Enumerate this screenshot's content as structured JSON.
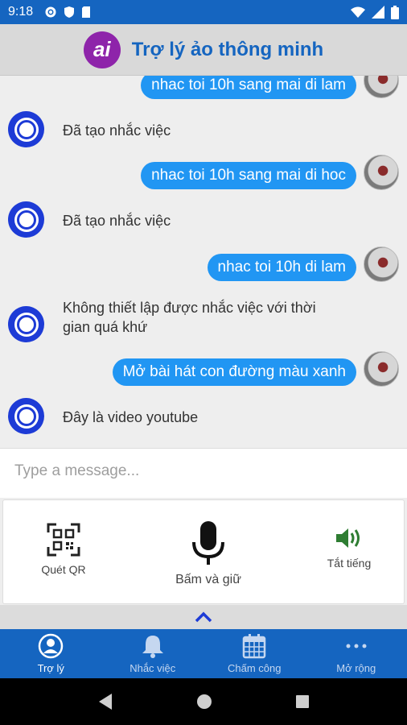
{
  "status_bar": {
    "time": "9:18"
  },
  "header": {
    "logo_text": "ai",
    "title": "Trợ lý ảo thông minh"
  },
  "messages": [
    {
      "from": "user",
      "text": "nhac toi 10h sang mai di lam"
    },
    {
      "from": "bot",
      "text": "Đã tạo nhắc việc"
    },
    {
      "from": "user",
      "text": "nhac toi 10h sang mai di hoc"
    },
    {
      "from": "bot",
      "text": "Đã tạo nhắc việc"
    },
    {
      "from": "user",
      "text": "nhac toi 10h di lam"
    },
    {
      "from": "bot",
      "text": "Không thiết lập được nhắc việc với thời gian quá khứ"
    },
    {
      "from": "user",
      "text": "Mở bài hát con đường màu xanh"
    },
    {
      "from": "bot",
      "text": "Đây là video youtube"
    }
  ],
  "composer": {
    "placeholder": "Type a message..."
  },
  "actions": {
    "qr_label": "Quét QR",
    "mic_label": "Bấm và giữ",
    "mute_label": "Tắt tiếng"
  },
  "bottom_nav": [
    {
      "label": "Trợ lý",
      "icon": "user-circle-icon",
      "active": true
    },
    {
      "label": "Nhắc việc",
      "icon": "bell-icon",
      "active": false
    },
    {
      "label": "Chấm công",
      "icon": "calendar-icon",
      "active": false
    },
    {
      "label": "Mở rộng",
      "icon": "more-dots-icon",
      "active": false
    }
  ],
  "colors": {
    "primary": "#1565c0",
    "bubble": "#2196f3",
    "logo": "#8e24aa",
    "speaker": "#2e7d32"
  }
}
